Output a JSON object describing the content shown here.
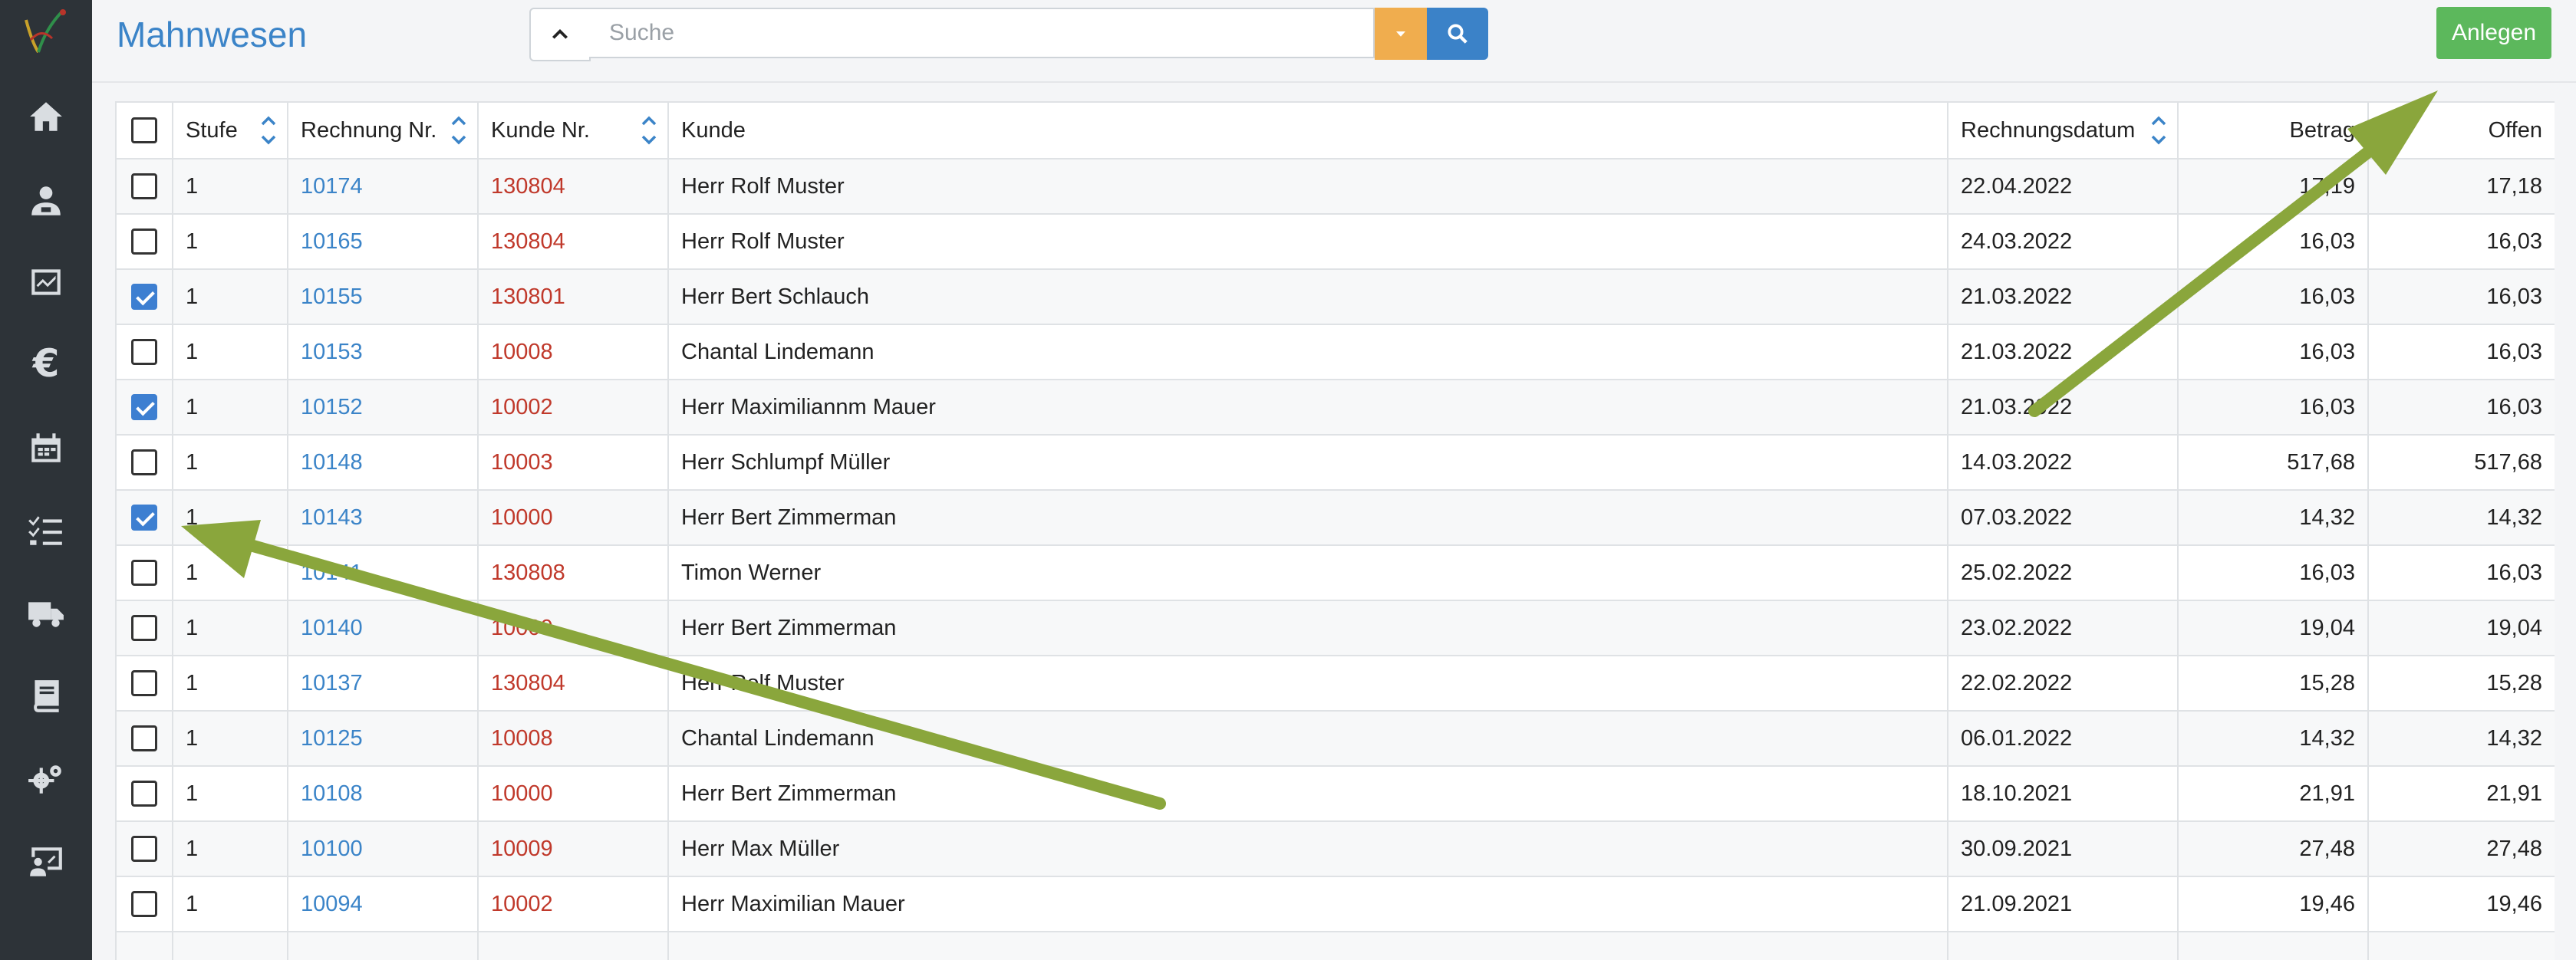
{
  "page": {
    "title": "Mahnwesen"
  },
  "search": {
    "placeholder": "Suche",
    "value": ""
  },
  "toolbar": {
    "create_label": "Anlegen"
  },
  "sidebar": {
    "items": [
      {
        "name": "home-icon"
      },
      {
        "name": "customers-icon"
      },
      {
        "name": "dashboard-icon"
      },
      {
        "name": "euro-icon",
        "glyph": "€"
      },
      {
        "name": "calendar-icon"
      },
      {
        "name": "tasks-icon"
      },
      {
        "name": "truck-icon"
      },
      {
        "name": "book-icon"
      },
      {
        "name": "gears-icon"
      },
      {
        "name": "presentation-icon"
      }
    ]
  },
  "table": {
    "columns": [
      "Stufe",
      "Rechnung Nr.",
      "Kunde Nr.",
      "Kunde",
      "Rechnungsdatum",
      "Betrag",
      "Offen"
    ],
    "rows": [
      {
        "checked": false,
        "stufe": "1",
        "rechnung": "10174",
        "kunde_nr": "130804",
        "kunde": "Herr Rolf Muster",
        "datum": "22.04.2022",
        "betrag": "17,19",
        "offen": "17,18"
      },
      {
        "checked": false,
        "stufe": "1",
        "rechnung": "10165",
        "kunde_nr": "130804",
        "kunde": "Herr Rolf Muster",
        "datum": "24.03.2022",
        "betrag": "16,03",
        "offen": "16,03"
      },
      {
        "checked": true,
        "stufe": "1",
        "rechnung": "10155",
        "kunde_nr": "130801",
        "kunde": "Herr Bert Schlauch",
        "datum": "21.03.2022",
        "betrag": "16,03",
        "offen": "16,03"
      },
      {
        "checked": false,
        "stufe": "1",
        "rechnung": "10153",
        "kunde_nr": "10008",
        "kunde": "Chantal Lindemann",
        "datum": "21.03.2022",
        "betrag": "16,03",
        "offen": "16,03"
      },
      {
        "checked": true,
        "stufe": "1",
        "rechnung": "10152",
        "kunde_nr": "10002",
        "kunde": "Herr Maximiliannm Mauer",
        "datum": "21.03.2022",
        "betrag": "16,03",
        "offen": "16,03"
      },
      {
        "checked": false,
        "stufe": "1",
        "rechnung": "10148",
        "kunde_nr": "10003",
        "kunde": "Herr Schlumpf Müller",
        "datum": "14.03.2022",
        "betrag": "517,68",
        "offen": "517,68"
      },
      {
        "checked": true,
        "stufe": "1",
        "rechnung": "10143",
        "kunde_nr": "10000",
        "kunde": "Herr Bert Zimmerman",
        "datum": "07.03.2022",
        "betrag": "14,32",
        "offen": "14,32"
      },
      {
        "checked": false,
        "stufe": "1",
        "rechnung": "10141",
        "kunde_nr": "130808",
        "kunde": "Timon Werner",
        "datum": "25.02.2022",
        "betrag": "16,03",
        "offen": "16,03"
      },
      {
        "checked": false,
        "stufe": "1",
        "rechnung": "10140",
        "kunde_nr": "10000",
        "kunde": "Herr Bert Zimmerman",
        "datum": "23.02.2022",
        "betrag": "19,04",
        "offen": "19,04"
      },
      {
        "checked": false,
        "stufe": "1",
        "rechnung": "10137",
        "kunde_nr": "130804",
        "kunde": "Herr Rolf Muster",
        "datum": "22.02.2022",
        "betrag": "15,28",
        "offen": "15,28"
      },
      {
        "checked": false,
        "stufe": "1",
        "rechnung": "10125",
        "kunde_nr": "10008",
        "kunde": "Chantal Lindemann",
        "datum": "06.01.2022",
        "betrag": "14,32",
        "offen": "14,32"
      },
      {
        "checked": false,
        "stufe": "1",
        "rechnung": "10108",
        "kunde_nr": "10000",
        "kunde": "Herr Bert Zimmerman",
        "datum": "18.10.2021",
        "betrag": "21,91",
        "offen": "21,91"
      },
      {
        "checked": false,
        "stufe": "1",
        "rechnung": "10100",
        "kunde_nr": "10009",
        "kunde": "Herr Max Müller",
        "datum": "30.09.2021",
        "betrag": "27,48",
        "offen": "27,48"
      },
      {
        "checked": false,
        "stufe": "1",
        "rechnung": "10094",
        "kunde_nr": "10002",
        "kunde": "Herr Maximilian Mauer",
        "datum": "21.09.2021",
        "betrag": "19,46",
        "offen": "19,46"
      },
      {
        "checked": false,
        "stufe": "",
        "rechnung": "",
        "kunde_nr": "",
        "kunde": "",
        "datum": "",
        "betrag": "",
        "offen": ""
      }
    ]
  },
  "colors": {
    "accent": "#3b84c8",
    "customer_link": "#c0392b",
    "create": "#5cb85c",
    "dropdown": "#f0ad4e",
    "annotation_arrow": "#8aa63c",
    "sidebar": "#2d3338"
  }
}
